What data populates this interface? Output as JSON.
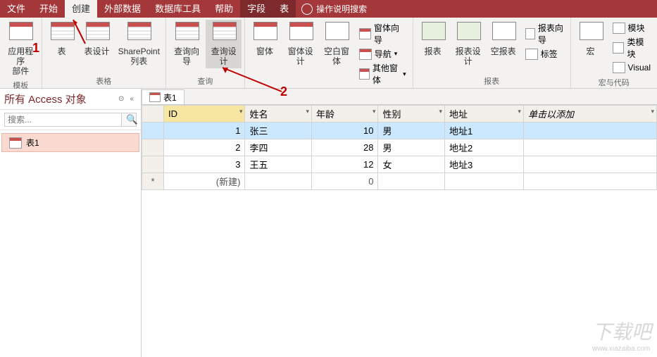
{
  "tabs": {
    "file": "文件",
    "home": "开始",
    "create": "创建",
    "external": "外部数据",
    "dbtools": "数据库工具",
    "help": "帮助",
    "field": "字段",
    "table": "表",
    "search": "操作说明搜索"
  },
  "ribbon": {
    "app_parts": "应用程序\n部件",
    "templates_group": "模板",
    "table": "表",
    "table_design": "表设计",
    "sharepoint": "SharePoint\n列表",
    "tables_group": "表格",
    "query_wizard": "查询向导",
    "query_design": "查询设计",
    "query_group": "查询",
    "form": "窗体",
    "form_design": "窗体设计",
    "blank_form": "空白窗体",
    "form_wizard": "窗体向导",
    "nav": "导航",
    "other_forms": "其他窗体",
    "forms_group": "窗体",
    "report": "报表",
    "report_design": "报表设计",
    "blank_report": "空报表",
    "report_wizard": "报表向导",
    "labels": "标签",
    "reports_group": "报表",
    "macro": "宏",
    "module": "模块",
    "class_module": "类模块",
    "visual": "Visual",
    "code_group": "宏与代码"
  },
  "nav": {
    "title": "所有 Access 对象",
    "search_ph": "搜索...",
    "item1": "表1"
  },
  "doc": {
    "tab1": "表1"
  },
  "columns": {
    "id": "ID",
    "name": "姓名",
    "age": "年龄",
    "gender": "性别",
    "address": "地址",
    "add": "单击以添加"
  },
  "rows": [
    {
      "id": "1",
      "name": "张三",
      "age": "10",
      "gender": "男",
      "address": "地址1"
    },
    {
      "id": "2",
      "name": "李四",
      "age": "28",
      "gender": "男",
      "address": "地址2"
    },
    {
      "id": "3",
      "name": "王五",
      "age": "12",
      "gender": "女",
      "address": "地址3"
    }
  ],
  "newrow": {
    "label": "(新建)",
    "age": "0"
  },
  "annotations": {
    "a1": "1",
    "a2": "2"
  },
  "watermark": {
    "big": "下载吧",
    "small": "www.xiazaiba.com"
  }
}
